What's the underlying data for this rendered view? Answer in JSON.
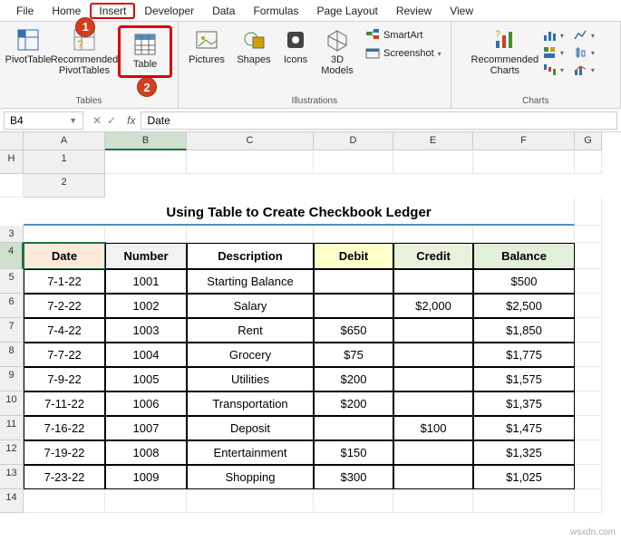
{
  "menu": {
    "items": [
      "File",
      "Home",
      "Insert",
      "Developer",
      "Data",
      "Formulas",
      "Page Layout",
      "Review",
      "View"
    ],
    "active": "Insert"
  },
  "callouts": {
    "c1": "1",
    "c2": "2"
  },
  "ribbon": {
    "tables": {
      "label": "Tables",
      "pivot": "PivotTable",
      "rec": "Recommended PivotTables",
      "table": "Table"
    },
    "illus": {
      "label": "Illustrations",
      "pics": "Pictures",
      "shapes": "Shapes",
      "icons": "Icons",
      "models": "3D Models",
      "smartart": "SmartArt",
      "screenshot": "Screenshot"
    },
    "charts": {
      "label": "Charts",
      "rec": "Recommended Charts"
    }
  },
  "formula_bar": {
    "cell_ref": "B4",
    "value": "Date"
  },
  "columns": [
    "A",
    "B",
    "C",
    "D",
    "E",
    "F",
    "G",
    "H"
  ],
  "title": "Using Table to Create Checkbook Ledger",
  "headers": {
    "date": "Date",
    "number": "Number",
    "desc": "Description",
    "debit": "Debit",
    "credit": "Credit",
    "balance": "Balance"
  },
  "rows": [
    {
      "r": 5,
      "date": "7-1-22",
      "num": "1001",
      "desc": "Starting Balance",
      "debit": "",
      "credit": "",
      "bal": "$500"
    },
    {
      "r": 6,
      "date": "7-2-22",
      "num": "1002",
      "desc": "Salary",
      "debit": "",
      "credit": "$2,000",
      "bal": "$2,500"
    },
    {
      "r": 7,
      "date": "7-4-22",
      "num": "1003",
      "desc": "Rent",
      "debit": "$650",
      "credit": "",
      "bal": "$1,850"
    },
    {
      "r": 8,
      "date": "7-7-22",
      "num": "1004",
      "desc": "Grocery",
      "debit": "$75",
      "credit": "",
      "bal": "$1,775"
    },
    {
      "r": 9,
      "date": "7-9-22",
      "num": "1005",
      "desc": "Utilities",
      "debit": "$200",
      "credit": "",
      "bal": "$1,575"
    },
    {
      "r": 10,
      "date": "7-11-22",
      "num": "1006",
      "desc": "Transportation",
      "debit": "$200",
      "credit": "",
      "bal": "$1,375"
    },
    {
      "r": 11,
      "date": "7-16-22",
      "num": "1007",
      "desc": "Deposit",
      "debit": "",
      "credit": "$100",
      "bal": "$1,475"
    },
    {
      "r": 12,
      "date": "7-19-22",
      "num": "1008",
      "desc": "Entertainment",
      "debit": "$150",
      "credit": "",
      "bal": "$1,325"
    },
    {
      "r": 13,
      "date": "7-23-22",
      "num": "1009",
      "desc": "Shopping",
      "debit": "$300",
      "credit": "",
      "bal": "$1,025"
    }
  ],
  "watermark": "wsxdn.com"
}
